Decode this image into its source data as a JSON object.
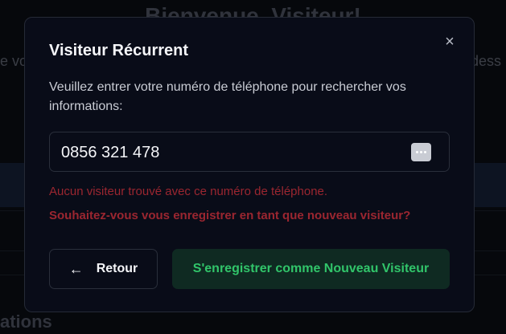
{
  "background": {
    "title_fragment": "Bienvenue, Visiteur!",
    "left_fragment": "e vo",
    "right_fragment": "dess",
    "bottom_fragment": "ations"
  },
  "modal": {
    "title": "Visiteur Récurrent",
    "close_icon": "×",
    "description": "Veuillez entrer votre numéro de téléphone pour rechercher vos informations:",
    "phone": {
      "value": "0856 321 478",
      "placeholder": ""
    },
    "error_message": "Aucun visiteur trouvé avec ce numéro de téléphone.",
    "error_question": "Souhaitez-vous vous enregistrer en tant que nouveau visiteur?",
    "back_button": {
      "arrow": "←",
      "label": "Retour"
    },
    "register_button": {
      "label": "S'enregistrer comme Nouveau Visiteur"
    }
  },
  "colors": {
    "error": "#9b2630",
    "success_text": "#31c56a",
    "success_bg": "#0f2a22",
    "modal_bg": "#090c18"
  }
}
